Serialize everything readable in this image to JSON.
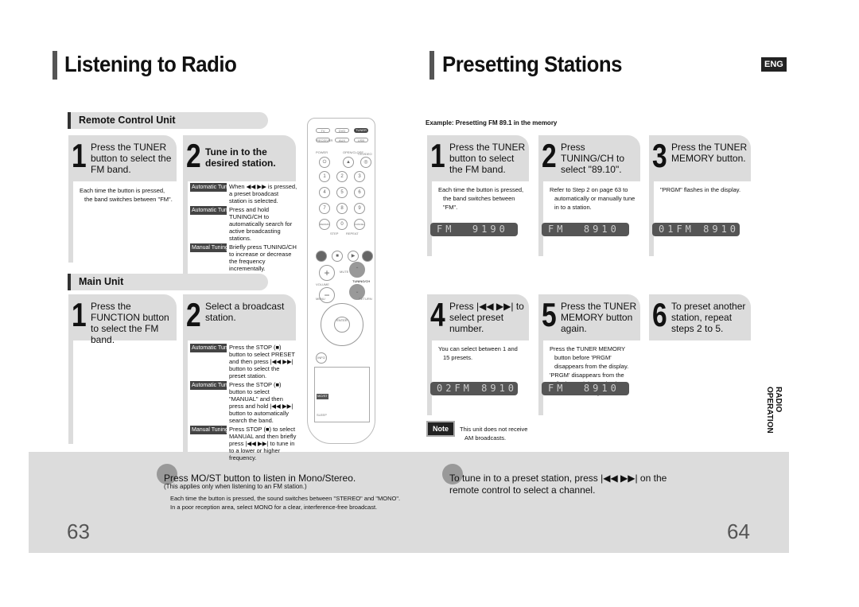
{
  "left": {
    "title": "Listening to Radio",
    "remote_header": "Remote Control Unit",
    "remote_steps": [
      {
        "num": "1",
        "text": "Press the TUNER button to select the FM band.",
        "note": "Each time the button is pressed, the band switches between \"FM\"."
      },
      {
        "num": "2",
        "text": "Tune in to the desired station.",
        "modes": [
          {
            "tag": "Automatic Tuning 1",
            "text": "When ◀◀ ▶▶ is pressed, a preset broadcast station is selected."
          },
          {
            "tag": "Automatic Tuning 2",
            "text": "Press and hold TUNING/CH to automatically search for active broadcasting stations."
          },
          {
            "tag": "Manual Tuning",
            "text": "Briefly press TUNING/CH to increase or decrease the frequency incrementally."
          }
        ]
      }
    ],
    "main_header": "Main Unit",
    "main_steps": [
      {
        "num": "1",
        "text": "Press the FUNCTION button to select the FM band."
      },
      {
        "num": "2",
        "text": "Select a broadcast station.",
        "modes": [
          {
            "tag": "Automatic Tuning 1",
            "text": "Press the STOP (■) button to select PRESET and then press |◀◀ ▶▶| button to select the preset station."
          },
          {
            "tag": "Automatic Tuning 2",
            "text": "Press the STOP (■) button to select \"MANUAL\" and then press and hold |◀◀ ▶▶| button to automatically search the band."
          },
          {
            "tag": "Manual Tuning",
            "text": "Press STOP (■) to select MANUAL and then briefly press |◀◀ ▶▶| to tune in to a lower or higher frequency."
          }
        ]
      }
    ],
    "mono": {
      "main": "Press MO/ST button to listen in Mono/Stereo.",
      "sub": "(This applies only when listening to an FM station.)",
      "bullets": [
        "Each time the button is pressed, the sound switches between \"STEREO\" and \"MONO\".",
        "In a poor reception area, select MONO for a clear, interference-free broadcast."
      ]
    },
    "page_number": "63"
  },
  "remote": {
    "top": [
      "TV",
      "DVD",
      "TUNER",
      "RECEIVER",
      "AUX",
      "USB"
    ],
    "power": "POWER",
    "open": "OPEN/CLOSE",
    "tv_video": "TV/VIDEO",
    "digits": [
      "1",
      "2",
      "3",
      "4",
      "5",
      "6",
      "7",
      "8",
      "9",
      "REMAIN",
      "0",
      "CANCEL"
    ],
    "step": "STEP",
    "repeat": "REPEAT",
    "mute": "MUTE",
    "volume": "VOLUME",
    "tuning": "TUNING/CH",
    "menu": "MENU",
    "return": "RETURN",
    "enter": "ENTER",
    "info": "INFO",
    "mo_st": "MO/ST",
    "sleep": "SLEEP"
  },
  "right": {
    "title": "Presetting Stations",
    "lang_badge": "ENG",
    "example": "Example: Presetting FM 89.1 in the memory",
    "steps": [
      {
        "num": "1",
        "text": "Press the TUNER button to select the FM band.",
        "bullets": [
          "Each time the button is pressed, the band switches between \"FM\"."
        ],
        "display": "FM  9190"
      },
      {
        "num": "2",
        "text": "Press TUNING/CH to select \"89.10\".",
        "bullets": [
          "Refer to Step 2 on page 63 to automatically or manually tune in to a station."
        ],
        "display": "FM  8910"
      },
      {
        "num": "3",
        "text": "Press the TUNER MEMORY button.",
        "bullets": [
          "\"PRGM\" flashes in the display."
        ],
        "display": "01FM 8910"
      },
      {
        "num": "4",
        "text": "Press |◀◀ ▶▶| to select preset number.",
        "bullets": [
          "You can select between 1 and 15 presets."
        ],
        "display": "02FM 8910"
      },
      {
        "num": "5",
        "text": "Press the TUNER MEMORY button again.",
        "bullets": [
          "Press the TUNER MEMORY button before 'PRGM' disappears from the display.",
          "'PRGM' disappears from the display and the station is stored in memory."
        ],
        "display": "FM  8910"
      },
      {
        "num": "6",
        "text": "To preset another station, repeat steps 2 to 5.",
        "bullets": [],
        "display": ""
      }
    ],
    "note_label": "Note",
    "note_text": "This unit does not receive AM broadcasts.",
    "preset_tip": "To tune in to a preset station, press |◀◀ ▶▶| on the remote control to select a channel.",
    "side_tab": "RADIO OPERATION",
    "page_number": "64"
  }
}
